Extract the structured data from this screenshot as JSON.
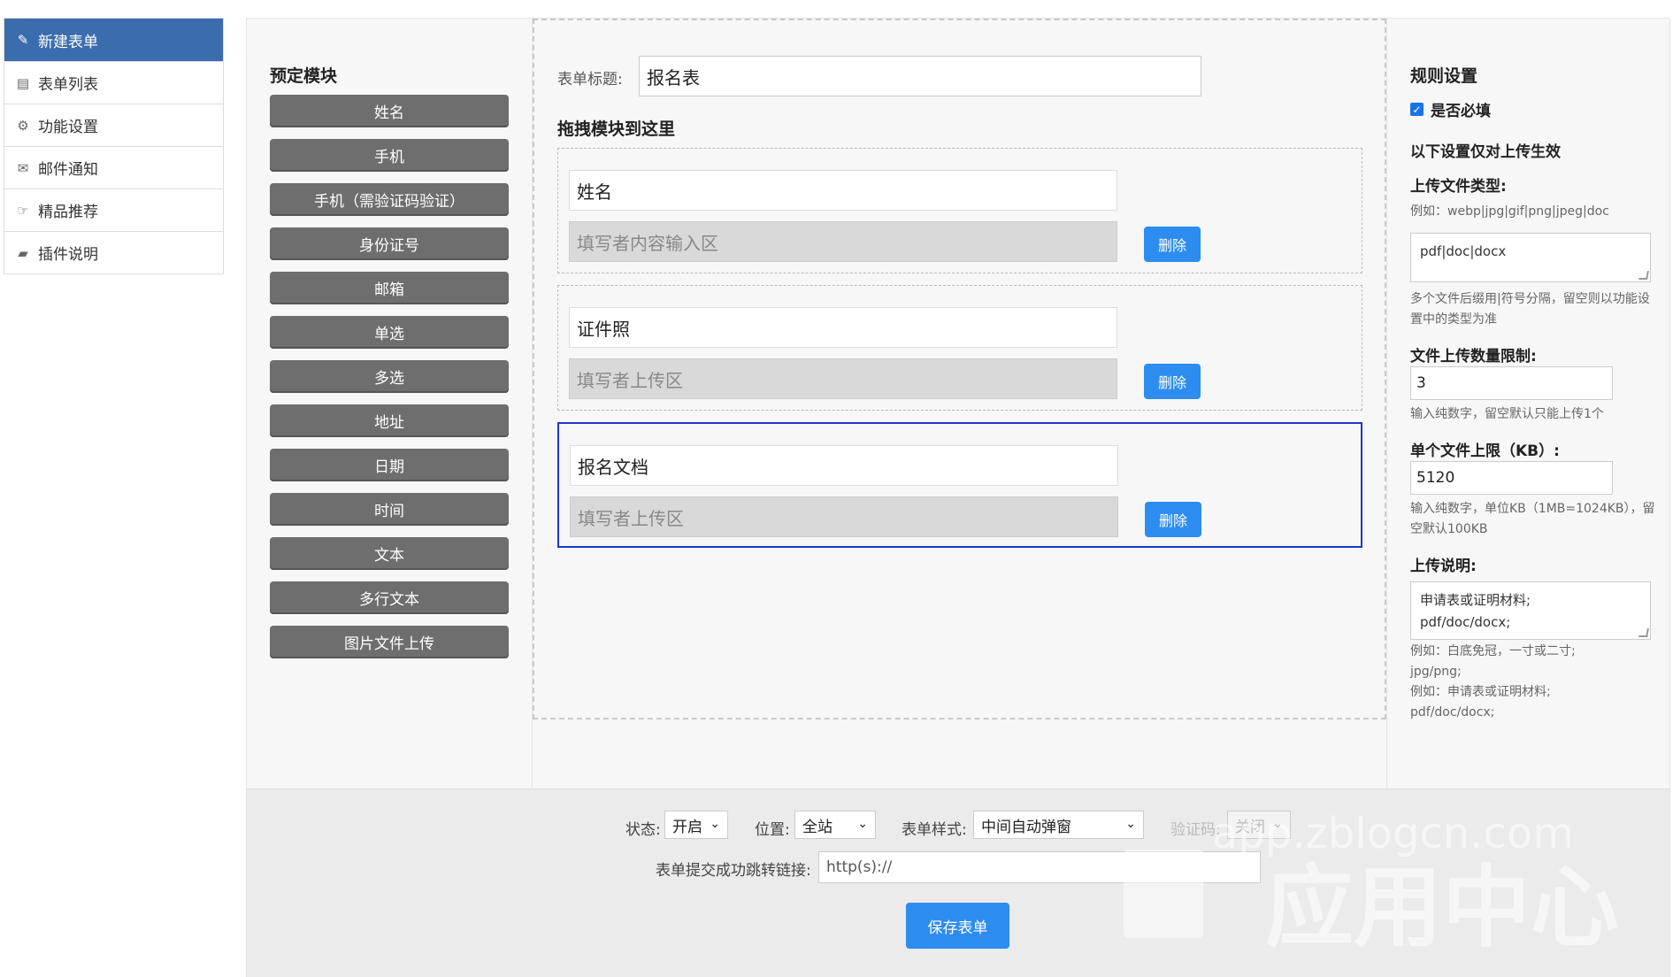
{
  "sidebar": {
    "items": [
      {
        "label": "新建表单",
        "icon": "edit-icon"
      },
      {
        "label": "表单列表",
        "icon": "list-icon"
      },
      {
        "label": "功能设置",
        "icon": "gear-icon"
      },
      {
        "label": "邮件通知",
        "icon": "mail-icon"
      },
      {
        "label": "精品推荐",
        "icon": "thumbs-up-icon"
      },
      {
        "label": "插件说明",
        "icon": "book-icon"
      }
    ]
  },
  "presets": {
    "title": "预定模块",
    "items": [
      "姓名",
      "手机",
      "手机（需验证码验证）",
      "身份证号",
      "邮箱",
      "单选",
      "多选",
      "地址",
      "日期",
      "时间",
      "文本",
      "多行文本",
      "图片文件上传"
    ]
  },
  "form": {
    "title_label": "表单标题:",
    "title_value": "报名表",
    "drop_heading": "拖拽模块到这里",
    "delete_label": "删除",
    "blocks": [
      {
        "label": "姓名",
        "placeholder": "填写者内容输入区"
      },
      {
        "label": "证件照",
        "placeholder": "填写者上传区"
      },
      {
        "label": "报名文档",
        "placeholder": "填写者上传区"
      }
    ]
  },
  "rules": {
    "title": "规则设置",
    "required_label": "是否必填",
    "upload_only_note": "以下设置仅对上传生效",
    "file_type_label": "上传文件类型:",
    "file_type_example": "例如：webp|jpg|gif|png|jpeg|doc",
    "file_type_value": "pdf|doc|docx",
    "file_type_hint": "多个文件后缀用|符号分隔，留空则以功能设置中的类型为准",
    "count_label": "文件上传数量限制:",
    "count_value": "3",
    "count_hint": "输入纯数字，留空默认只能上传1个",
    "size_label": "单个文件上限（KB）:",
    "size_value": "5120",
    "size_hint": "输入纯数字，单位KB（1MB=1024KB），留空默认100KB",
    "desc_label": "上传说明:",
    "desc_value_1": "申请表或证明材料;",
    "desc_value_2": "pdf/doc/docx;",
    "desc_hint_1": "例如：白底免冠，一寸或二寸;",
    "desc_hint_2": "jpg/png;",
    "desc_hint_3": "例如：申请表或证明材料;",
    "desc_hint_4": "pdf/doc/docx;"
  },
  "footer": {
    "status_label": "状态:",
    "status_value": "开启",
    "position_label": "位置:",
    "position_value": "全站",
    "style_label": "表单样式:",
    "style_value": "中间自动弹窗",
    "captcha_label": "验证码:",
    "captcha_value": "关闭",
    "redirect_label": "表单提交成功跳转链接:",
    "redirect_placeholder": "http(s)://",
    "save_label": "保存表单"
  },
  "watermark": {
    "line1": "app.zblogcn.com",
    "line2": "应用中心"
  },
  "colors": {
    "accent": "#2d8cf0",
    "sidebar_active": "#3a6cae",
    "selected_border": "#2233cc",
    "preset_button": "#6e6e6e"
  }
}
